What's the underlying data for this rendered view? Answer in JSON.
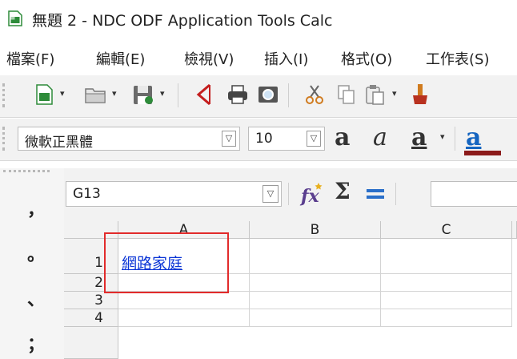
{
  "window": {
    "title": "無題 2 - NDC ODF Application Tools Calc",
    "icon": "calc-document-icon"
  },
  "menu": [
    "檔案(F)",
    "編輯(E)",
    "檢視(V)",
    "插入(I)",
    "格式(O)",
    "工作表(S)"
  ],
  "toolbar_standard": {
    "buttons": [
      "new-document-icon",
      "open-folder-icon",
      "save-icon",
      "export-pdf-icon",
      "print-icon",
      "print-preview-icon",
      "cut-icon",
      "copy-icon",
      "paste-icon",
      "clone-formatting-icon"
    ]
  },
  "toolbar_formatting": {
    "font_name": "微軟正黑體",
    "font_size": "10",
    "buttons": [
      "bold-icon",
      "italic-icon",
      "underline-icon",
      "font-color-icon"
    ]
  },
  "formula_bar": {
    "name_box": "G13",
    "buttons": [
      "function-wizard-icon",
      "sum-icon",
      "formula-icon"
    ],
    "input_value": ""
  },
  "left_punctuation": [
    "，",
    "。",
    "、",
    "；"
  ],
  "sheet": {
    "columns": [
      "A",
      "B",
      "C"
    ],
    "rows": [
      "1",
      "2",
      "3",
      "4"
    ],
    "cells": {
      "A1": "網路家庭"
    }
  },
  "colors": {
    "link": "#0b35d6",
    "highlight": "#e22b2b",
    "toolbar_bg": "#f2f2f2"
  }
}
